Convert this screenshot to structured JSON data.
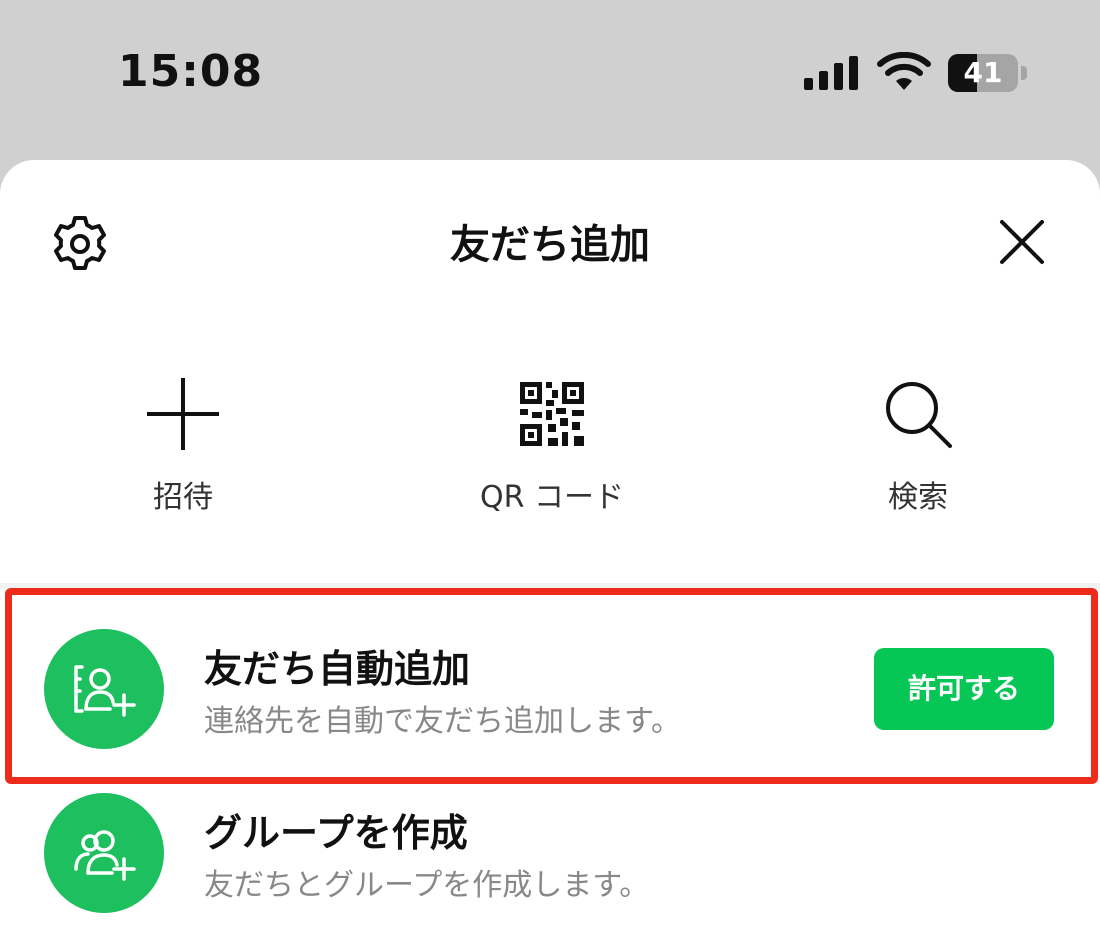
{
  "status_bar": {
    "time": "15:08",
    "battery_level": "41",
    "battery_fraction": 0.41
  },
  "header": {
    "title": "友だち追加",
    "settings_icon": "gear-icon",
    "close_icon": "close-icon"
  },
  "actions": [
    {
      "label": "招待",
      "icon": "plus-icon"
    },
    {
      "label": "QR コード",
      "icon": "qr-code-icon"
    },
    {
      "label": "検索",
      "icon": "search-icon"
    }
  ],
  "list": {
    "auto_add": {
      "title": "友だち自動追加",
      "description": "連絡先を自動で友だち追加します。",
      "button_label": "許可する",
      "icon": "contact-add-icon"
    },
    "create_group": {
      "title": "グループを作成",
      "description": "友だちとグループを作成します。",
      "icon": "group-add-icon"
    }
  },
  "colors": {
    "accent": "#06c755",
    "avatar": "#1dbf5f",
    "highlight": "#ee2a1a",
    "backdrop": "#d0d0d0"
  }
}
